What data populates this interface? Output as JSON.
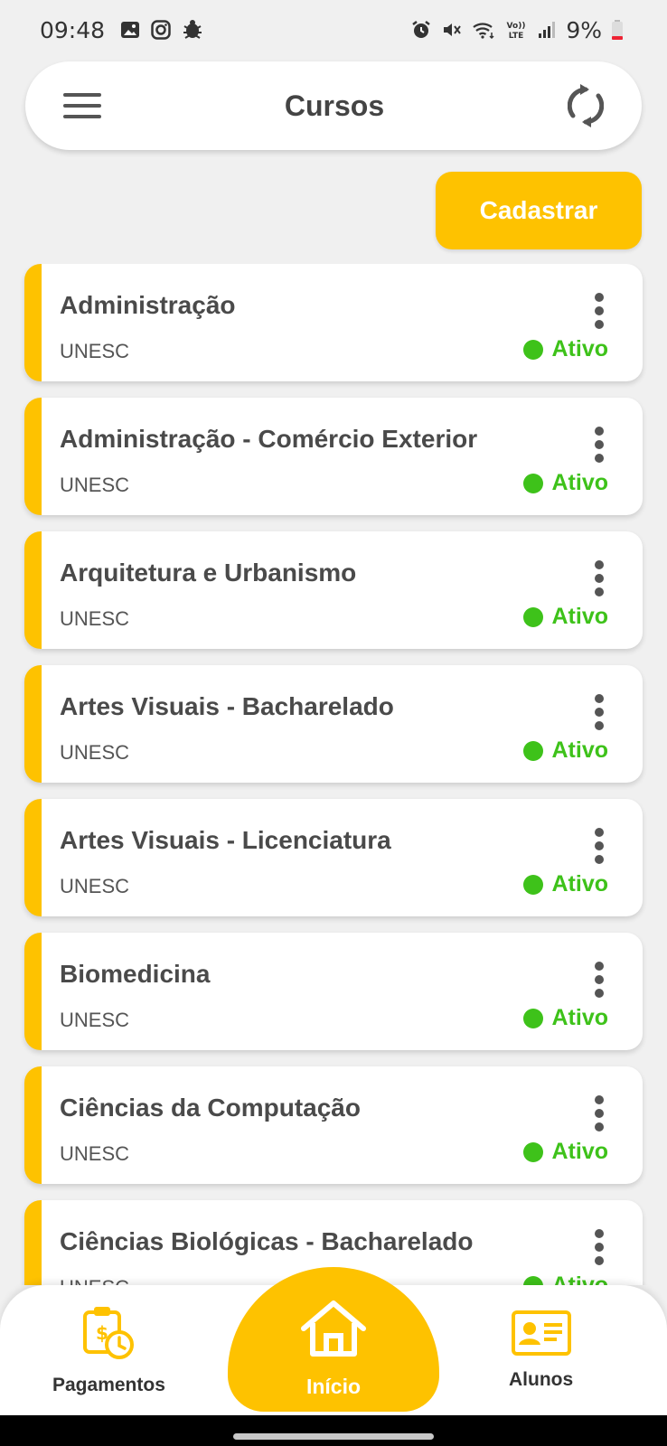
{
  "status_bar": {
    "time": "09:48",
    "battery": "9%",
    "left_icons": [
      "gallery-icon",
      "instagram-icon",
      "bug-icon"
    ],
    "right_icons": [
      "alarm-icon",
      "mute-icon",
      "wifi-icon",
      "lte-icon",
      "signal-icon",
      "battery-icon"
    ]
  },
  "header": {
    "title": "Cursos",
    "menu_icon": "hamburger-menu-icon",
    "refresh_icon": "refresh-icon"
  },
  "actions": {
    "register_label": "Cadastrar"
  },
  "courses": [
    {
      "name": "Administração",
      "org": "UNESC",
      "status": "Ativo"
    },
    {
      "name": "Administração - Comércio Exterior",
      "org": "UNESC",
      "status": "Ativo"
    },
    {
      "name": "Arquitetura e Urbanismo",
      "org": "UNESC",
      "status": "Ativo"
    },
    {
      "name": "Artes Visuais - Bacharelado",
      "org": "UNESC",
      "status": "Ativo"
    },
    {
      "name": "Artes Visuais - Licenciatura",
      "org": "UNESC",
      "status": "Ativo"
    },
    {
      "name": "Biomedicina",
      "org": "UNESC",
      "status": "Ativo"
    },
    {
      "name": "Ciências da Computação",
      "org": "UNESC",
      "status": "Ativo"
    },
    {
      "name": "Ciências Biológicas - Bacharelado",
      "org": "UNESC",
      "status": "Ativo"
    }
  ],
  "bottom_nav": {
    "items": [
      {
        "label": "Pagamentos",
        "icon": "payment-calendar-icon"
      },
      {
        "label": "Início",
        "icon": "home-icon"
      },
      {
        "label": "Alunos",
        "icon": "id-card-icon"
      }
    ]
  },
  "colors": {
    "accent": "#fec200",
    "status_active": "#3ec21a",
    "background": "#f0f0f0"
  }
}
